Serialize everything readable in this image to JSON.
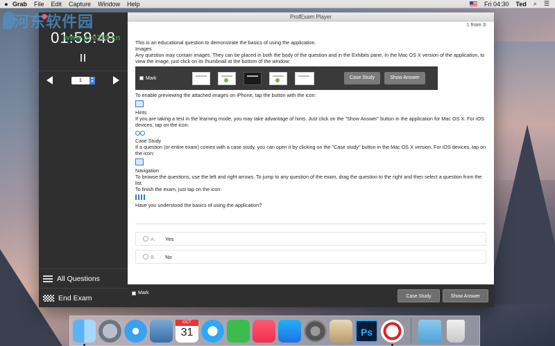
{
  "menubar": {
    "app_name": "Grab",
    "items": [
      "File",
      "Edit",
      "Capture",
      "Window",
      "Help"
    ],
    "clock": "Fri 04:30",
    "user": "Ted"
  },
  "watermark": {
    "text": "河东软件园",
    "url": "www.pc0359.cn"
  },
  "window": {
    "title": "ProfExam Player"
  },
  "sidebar": {
    "timer": "01:59:48",
    "question_number": "1",
    "all_questions_label": "All Questions",
    "end_exam_label": "End Exam"
  },
  "main": {
    "counter_current": "1",
    "counter_text": "from 3",
    "paragraphs": {
      "intro": "This is an educational question to demonstrate the basics of using the application.",
      "images_heading": "Images",
      "images_text": "Any question may contain images. They can be placed in both the body of the question and in the Exhibits pane. In the Mac OS X version of the application, to view the image, just click on its thumbnail at the bottom of the window:",
      "iphone_text": "To enable previewing the attached images on iPhone, tap the button with the icon:",
      "hints_heading": "Hints",
      "hints_text": "If you are taking a test in the learning mode, you may take advantage of hints. Just click on the \"Show Answer\" button in the application for Mac OS X. For iOS devices, tap on the icon:",
      "case_heading": "Case Study",
      "case_text": "If a question (or entire exam) comes with a case study, you can open it by clicking on the \"Case study\" button in the Mac OS X version. For iOS devices, tap on the icon:",
      "nav_heading": "Navigation",
      "nav_text": "To browse the questions, use the left and right arrows. To jump to any question of the exam, drag the question to the right and then select a question from the list.",
      "finish_text": "To finish the exam, just tap on the icon:",
      "question": "Have you understood the basics of using the application?"
    },
    "demo_toolbar": {
      "mark_label": "Mark",
      "case_study_label": "Case Study",
      "show_answer_label": "Show Answer"
    },
    "answers": [
      {
        "letter": "A.",
        "text": "Yes"
      },
      {
        "letter": "B.",
        "text": "No"
      }
    ]
  },
  "bottombar": {
    "mark_label": "Mark",
    "case_study_label": "Case Study",
    "show_answer_label": "Show Answer"
  },
  "dock": {
    "icons": [
      "finder-icon",
      "launchpad-icon",
      "safari-icon",
      "preview-icon",
      "calendar-icon",
      "messages-icon",
      "facetime-icon",
      "music-icon",
      "app-store-icon",
      "system-preferences-icon",
      "archive-utility-icon",
      "photoshop-icon",
      "pdf-editor-icon",
      "downloads-folder-icon",
      "trash-icon"
    ]
  },
  "colors": {
    "accent": "#2a6bd1",
    "sidebar_bg": "#2f2f2f",
    "close_button": "#fc605c"
  }
}
